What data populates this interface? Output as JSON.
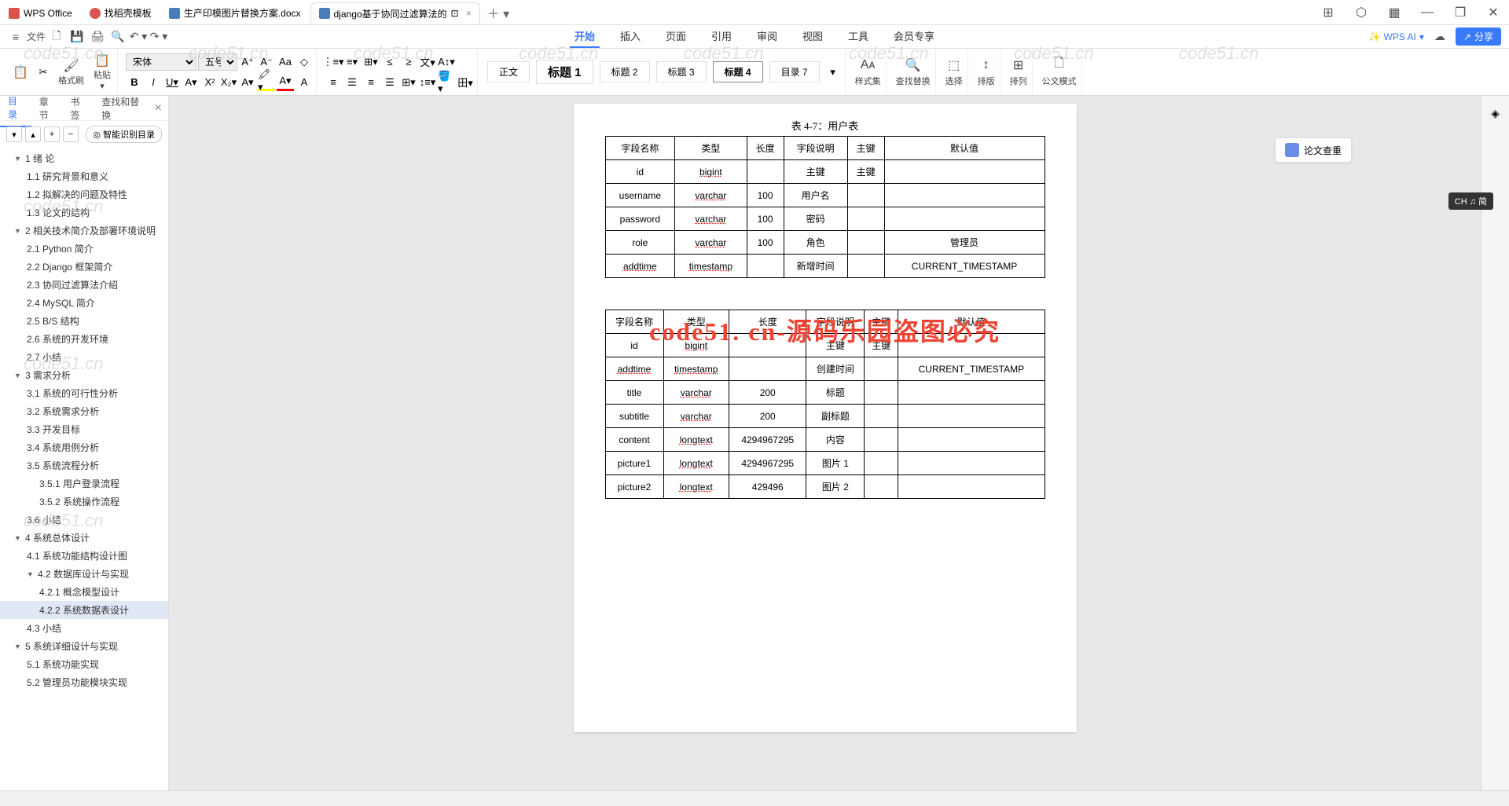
{
  "tabs": {
    "t0": "WPS Office",
    "t1": "找稻壳模板",
    "t2": "生产印模图片替换方案.docx",
    "t3": "django基于协同过滤算法的"
  },
  "file_label": "文件",
  "menu": {
    "start": "开始",
    "insert": "插入",
    "page": "页面",
    "ref": "引用",
    "review": "审阅",
    "view": "视图",
    "tool": "工具",
    "vip": "会员专享"
  },
  "wpsai": "WPS AI",
  "share": "分享",
  "ribbon": {
    "fmt_paint": "格式刷",
    "paste": "粘贴",
    "font_name": "宋体",
    "font_size": "五号",
    "styles": {
      "body": "正文",
      "h1": "标题 1",
      "h2": "标题 2",
      "h3": "标题 3",
      "h4": "标题 4",
      "toc7": "目录 7"
    },
    "style_lbl": "样式集",
    "find": "查找替换",
    "select": "选择",
    "sort": "排版",
    "arrange": "排列",
    "gov": "公文模式"
  },
  "nav": {
    "tabs": {
      "toc": "目录",
      "chapter": "章节",
      "bookmark": "书签",
      "find": "查找和替换"
    },
    "smart": "智能识别目录",
    "items": [
      {
        "l": 1,
        "exp": "▼",
        "t": "1 绪   论"
      },
      {
        "l": 2,
        "t": "1.1 研究背景和意义"
      },
      {
        "l": 2,
        "t": "1.2 拟解决的问题及特性"
      },
      {
        "l": 2,
        "t": "1.3 论文的结构"
      },
      {
        "l": 1,
        "exp": "▼",
        "t": "2  相关技术简介及部署环境说明"
      },
      {
        "l": 2,
        "t": "2.1 Python 简介"
      },
      {
        "l": 2,
        "t": "2.2 Django 框架简介"
      },
      {
        "l": 2,
        "t": "2.3 协同过滤算法介绍"
      },
      {
        "l": 2,
        "t": "2.4 MySQL 简介"
      },
      {
        "l": 2,
        "t": "2.5 B/S 结构"
      },
      {
        "l": 2,
        "t": "2.6 系统的开发环境"
      },
      {
        "l": 2,
        "t": "2.7 小结"
      },
      {
        "l": 1,
        "exp": "▼",
        "t": "3  需求分析"
      },
      {
        "l": 2,
        "t": "3.1 系统的可行性分析"
      },
      {
        "l": 2,
        "t": "3.2 系统需求分析"
      },
      {
        "l": 2,
        "t": "3.3 开发目标"
      },
      {
        "l": 2,
        "t": "3.4 系统用例分析"
      },
      {
        "l": 2,
        "t": "3.5 系统流程分析"
      },
      {
        "l": 3,
        "t": "3.5.1  用户登录流程"
      },
      {
        "l": 3,
        "t": "3.5.2  系统操作流程"
      },
      {
        "l": 2,
        "t": "3.6 小结"
      },
      {
        "l": 1,
        "exp": "▼",
        "t": "4  系统总体设计"
      },
      {
        "l": 2,
        "t": "4.1 系统功能结构设计图"
      },
      {
        "l": 2,
        "exp": "▼",
        "t": "4.2  数据库设计与实现"
      },
      {
        "l": 3,
        "t": "4.2.1  概念模型设计"
      },
      {
        "l": 3,
        "sel": true,
        "t": "4.2.2  系统数据表设计"
      },
      {
        "l": 2,
        "t": "4.3 小结"
      },
      {
        "l": 1,
        "exp": "▼",
        "t": "5  系统详细设计与实现"
      },
      {
        "l": 2,
        "t": "5.1 系统功能实现"
      },
      {
        "l": 2,
        "t": "5.2 管理员功能模块实现"
      }
    ]
  },
  "doc": {
    "caption1": "表 4-7：用户表",
    "headers": [
      "字段名称",
      "类型",
      "长度",
      "字段说明",
      "主键",
      "默认值"
    ],
    "table1": [
      [
        "id",
        "bigint",
        "",
        "主键",
        "主键",
        ""
      ],
      [
        "username",
        "varchar",
        "100",
        "用户名",
        "",
        ""
      ],
      [
        "password",
        "varchar",
        "100",
        "密码",
        "",
        ""
      ],
      [
        "role",
        "varchar",
        "100",
        "角色",
        "",
        "管理员"
      ],
      [
        "addtime",
        "timestamp",
        "",
        "新增时间",
        "",
        "CURRENT_TIMESTAMP"
      ]
    ],
    "overlay": "code51. cn-源码乐园盗图必究",
    "table2": [
      [
        "id",
        "bigint",
        "",
        "主键",
        "主键",
        ""
      ],
      [
        "addtime",
        "timestamp",
        "",
        "创建时间",
        "",
        "CURRENT_TIMESTAMP"
      ],
      [
        "title",
        "varchar",
        "200",
        "标题",
        "",
        ""
      ],
      [
        "subtitle",
        "varchar",
        "200",
        "副标题",
        "",
        ""
      ],
      [
        "content",
        "longtext",
        "4294967295",
        "内容",
        "",
        ""
      ],
      [
        "picture1",
        "longtext",
        "4294967295",
        "图片 1",
        "",
        ""
      ],
      [
        "picture2",
        "longtext",
        "429496",
        "图片 2",
        "",
        ""
      ]
    ]
  },
  "paper_check": "论文查重",
  "ime": "CH ♫ 简",
  "wm_text": "code51.cn"
}
